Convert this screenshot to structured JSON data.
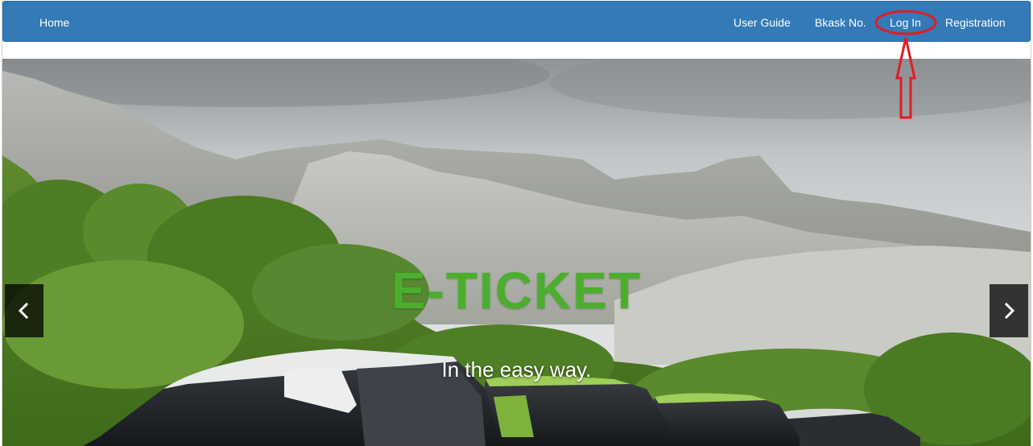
{
  "navbar": {
    "home_label": "Home",
    "user_guide_label": "User Guide",
    "bkask_label": "Bkask No.",
    "login_label": "Log In",
    "registration_label": "Registration",
    "background_color": "#337ab7"
  },
  "hero": {
    "title": "E-TICKET",
    "subtitle": "In the easy way.",
    "title_color": "#4cae2e",
    "prev_icon": "chevron-left-icon",
    "next_icon": "chevron-right-icon"
  },
  "annotation": {
    "highlight_color": "#e31b23",
    "target": "Log In"
  }
}
